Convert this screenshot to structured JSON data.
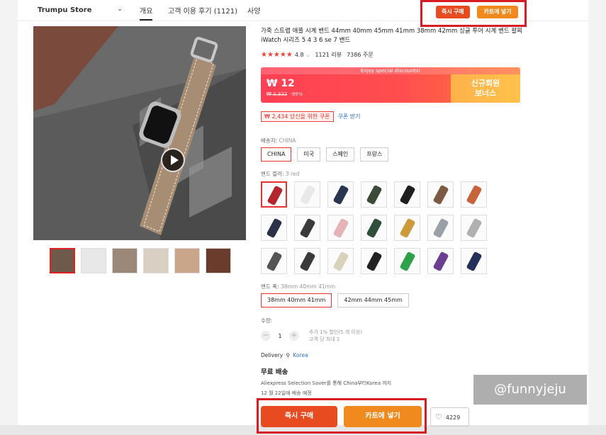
{
  "header": {
    "store_name": "Trumpu Store",
    "tabs": [
      "개요",
      "고객 이용 후기 (1121)",
      "사양"
    ],
    "buy_now_label": "즉시 구매",
    "add_cart_label": "카트에 넣기"
  },
  "product": {
    "title": "가죽 스트랩 애플 시계 밴드 44mm 40mm 45mm 41mm 38mm 42mm 싱글 투어 시계 밴드 팔찌 iWatch 시리즈 5 4 3 6 se 7 밴드",
    "stars": "★★★★★",
    "rating": "4.8",
    "reviews": "1121 리뷰",
    "orders": "7386 주문"
  },
  "promo": {
    "banner": "Enjoy special discounts!",
    "price": "₩ 12",
    "old_price": "₩ 3,322",
    "discount": "-99%",
    "bonus_line1": "신규회원",
    "bonus_line2": "보너스"
  },
  "coupon": {
    "label": "₩ 2,434 당신을 위한 쿠폰",
    "link": "쿠폰 받기"
  },
  "ship_from": {
    "label": "배송지: ",
    "selected": "CHINA",
    "options": [
      "CHINA",
      "미국",
      "스페인",
      "프랑스"
    ]
  },
  "band_color": {
    "label": "밴드 컬러: ",
    "selected": "3 red",
    "swatch_colors": [
      "#b3262d",
      "#e9e9e9",
      "#2a3550",
      "#3d4a38",
      "#1e1e1e",
      "#7c5a44",
      "#c8643c",
      "#2b3247",
      "#3a3a3a",
      "#e6b3b8",
      "#2f4f3a",
      "#cc9a3a",
      "#9aa0a8",
      "#b0b0b0",
      "#555555",
      "#3a3a3a",
      "#d8d2bc",
      "#222222",
      "#2fa14a",
      "#6a3f92",
      "#24325a"
    ]
  },
  "band_width": {
    "label": "밴드 폭: ",
    "selected": "38mm 40mm 41mm",
    "options": [
      "38mm 40mm 41mm",
      "42mm 44mm 45mm"
    ]
  },
  "quantity": {
    "label": "수량:",
    "minus": "−",
    "value": "1",
    "plus": "+",
    "note1": "추가 1% 할인(5 개 이상)",
    "note2": "고객 당 최대 1"
  },
  "delivery": {
    "label": "Delivery",
    "destination": "Korea",
    "free_shipping": "무료 배송",
    "line1": "Aliexpress Selection Saver를 통해 China부터Korea 까지",
    "line2": "12 월 22일에 배송 예정"
  },
  "actions": {
    "buy_now": "즉시 구매",
    "add_cart": "카트에 넣기",
    "wishlist_count": "4229"
  },
  "watermark": "@funnyjeju"
}
